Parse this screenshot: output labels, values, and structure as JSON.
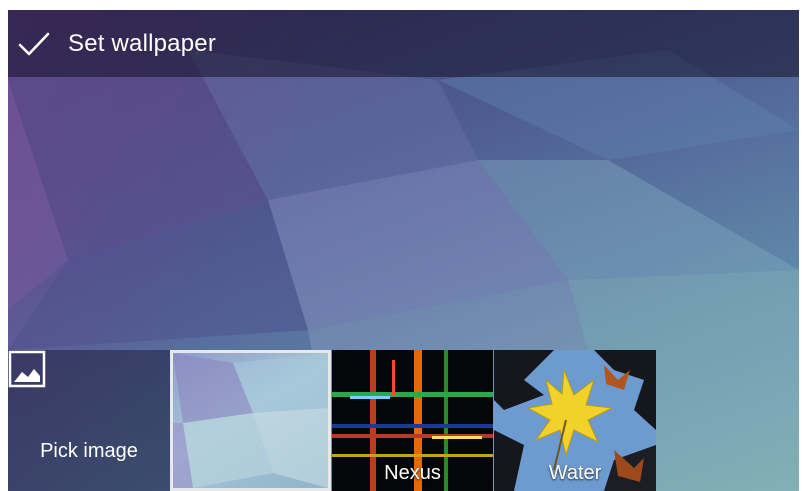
{
  "action_bar": {
    "title": "Set wallpaper",
    "done_icon": "checkmark-icon"
  },
  "wallpaper_strip": {
    "pick_image": {
      "label": "Pick image",
      "icon": "image-icon"
    },
    "tiles": [
      {
        "label": "",
        "selected": true
      },
      {
        "label": "Nexus",
        "selected": false
      },
      {
        "label": "Water",
        "selected": false
      }
    ]
  },
  "colors": {
    "action_bar_bg": "#1c1a32",
    "text": "#ffffff",
    "selected_border": "#e8e8e8"
  }
}
